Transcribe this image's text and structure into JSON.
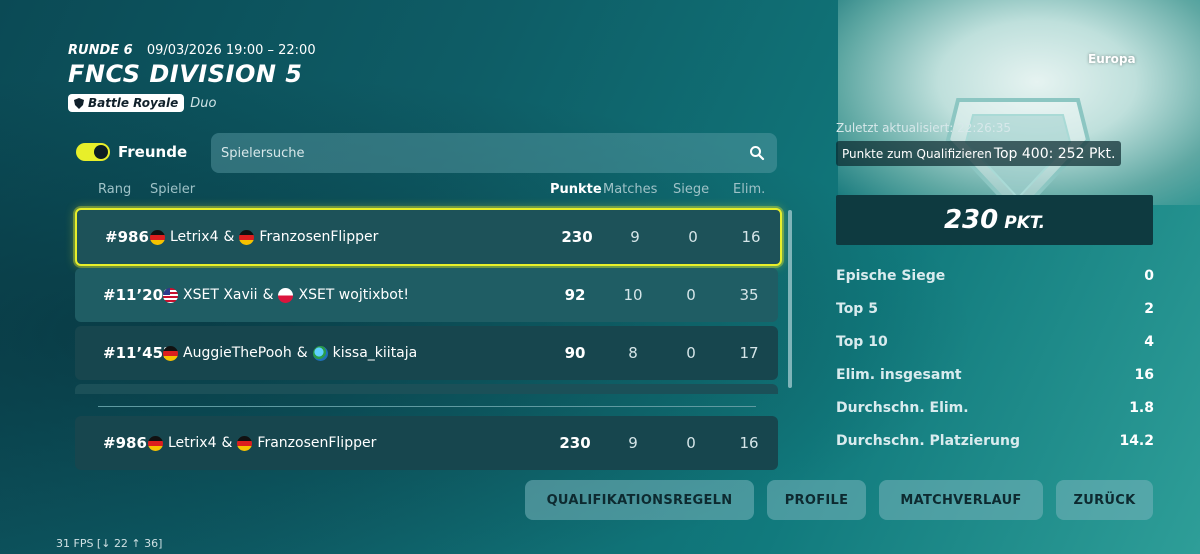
{
  "header": {
    "round": "RUNDE 6",
    "datetime": "09/03/2026 19:00 – 22:00",
    "title": "FNCS DIVISION 5",
    "mode_badge": "Battle Royale",
    "team_size": "Duo"
  },
  "keyart": {
    "region": "Europa"
  },
  "filters": {
    "friends_label": "Freunde",
    "friends_toggle_on": true,
    "search_placeholder": "Spielersuche"
  },
  "columns": {
    "rank": "Rang",
    "player": "Spieler",
    "points": "Punkte",
    "matches": "Matches",
    "wins": "Siege",
    "elims": "Elim."
  },
  "rows": [
    {
      "rank": "#986",
      "p1": "Letrix4",
      "p1_flag": "de",
      "sep": "&",
      "p2": "FranzosenFlipper",
      "p2_flag": "de",
      "points": "230",
      "matches": "9",
      "wins": "0",
      "elims": "16"
    },
    {
      "rank": "#11’208",
      "p1": "XSET Xavii",
      "p1_flag": "us",
      "sep": "&",
      "p2": "XSET wojtixbot!",
      "p2_flag": "pl",
      "points": "92",
      "matches": "10",
      "wins": "0",
      "elims": "35"
    },
    {
      "rank": "#11’452",
      "p1": "AuggieThePooh",
      "p1_flag": "de",
      "sep": "&",
      "p2": "kissa_kiitaja",
      "p2_flag": "globe",
      "points": "90",
      "matches": "8",
      "wins": "0",
      "elims": "17"
    }
  ],
  "own_row": {
    "rank": "#986",
    "p1": "Letrix4",
    "p1_flag": "de",
    "sep": "&",
    "p2": "FranzosenFlipper",
    "p2_flag": "de",
    "points": "230",
    "matches": "9",
    "wins": "0",
    "elims": "16"
  },
  "panel": {
    "updated": "Zuletzt aktualisiert: 22:26:35",
    "qualify_label": "Punkte zum Qualifizieren",
    "qualify_value": "Top 400: 252 Pkt.",
    "points_value": "230",
    "points_unit": "PKT.",
    "stats": [
      {
        "label": "Epische Siege",
        "value": "0"
      },
      {
        "label": "Top 5",
        "value": "2"
      },
      {
        "label": "Top 10",
        "value": "4"
      },
      {
        "label": "Elim. insgesamt",
        "value": "16"
      },
      {
        "label": "Durchschn. Elim.",
        "value": "1.8"
      },
      {
        "label": "Durchschn. Platzierung",
        "value": "14.2"
      }
    ]
  },
  "buttons": {
    "rules": "QUALIFIKATIONSREGELN",
    "profiles": "PROFILE",
    "history": "MATCHVERLAUF",
    "back": "ZURÜCK"
  },
  "fps": "31 FPS [↓ 22 ↑ 36]",
  "colors": {
    "highlight": "#e8ef2a",
    "panel_dark": "#0e3a40"
  }
}
